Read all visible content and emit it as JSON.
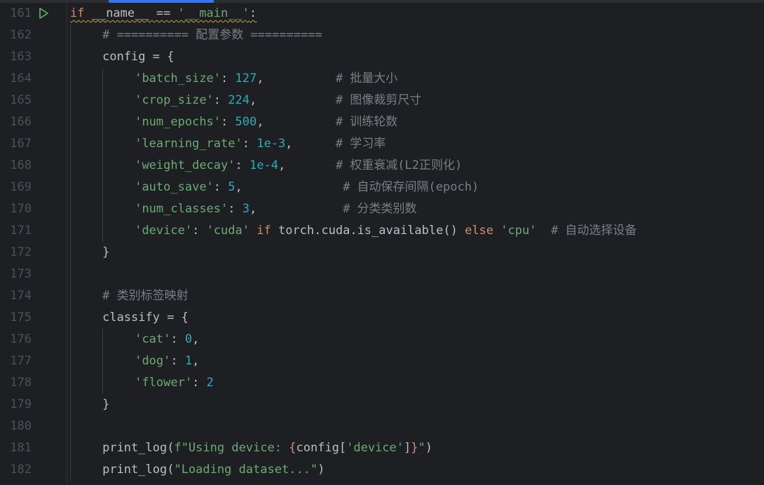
{
  "colors": {
    "background": "#1e1f22",
    "line_number": "#4b5059",
    "default": "#bcbec4",
    "keyword": "#cf8e6d",
    "string": "#6aab73",
    "number": "#2aacb8",
    "comment": "#7a7e85",
    "run_icon": "#5fb865"
  },
  "lines": [
    {
      "num": "161",
      "run": true,
      "indent": 0,
      "tokens": [
        {
          "t": "if",
          "c": "keyword",
          "sq": true
        },
        {
          "t": " __name__ == ",
          "c": "default",
          "sq": true
        },
        {
          "t": "'__main__'",
          "c": "string",
          "sq": true
        },
        {
          "t": ":",
          "c": "default",
          "sq": true
        }
      ]
    },
    {
      "num": "162",
      "indent": 4,
      "tokens": [
        {
          "t": "# ========== 配置参数 ==========",
          "c": "comment"
        }
      ]
    },
    {
      "num": "163",
      "indent": 4,
      "tokens": [
        {
          "t": "config = {",
          "c": "default"
        }
      ]
    },
    {
      "num": "164",
      "indent": 8,
      "tokens": [
        {
          "t": "'batch_size'",
          "c": "string"
        },
        {
          "t": ": ",
          "c": "default"
        },
        {
          "t": "127",
          "c": "number"
        },
        {
          "t": ",          ",
          "c": "default"
        },
        {
          "t": "# 批量大小",
          "c": "comment"
        }
      ]
    },
    {
      "num": "165",
      "indent": 8,
      "tokens": [
        {
          "t": "'crop_size'",
          "c": "string"
        },
        {
          "t": ": ",
          "c": "default"
        },
        {
          "t": "224",
          "c": "number"
        },
        {
          "t": ",           ",
          "c": "default"
        },
        {
          "t": "# 图像裁剪尺寸",
          "c": "comment"
        }
      ]
    },
    {
      "num": "166",
      "indent": 8,
      "tokens": [
        {
          "t": "'num_epochs'",
          "c": "string"
        },
        {
          "t": ": ",
          "c": "default"
        },
        {
          "t": "500",
          "c": "number"
        },
        {
          "t": ",          ",
          "c": "default"
        },
        {
          "t": "# 训练轮数",
          "c": "comment"
        }
      ]
    },
    {
      "num": "167",
      "indent": 8,
      "tokens": [
        {
          "t": "'learning_rate'",
          "c": "string"
        },
        {
          "t": ": ",
          "c": "default"
        },
        {
          "t": "1e-3",
          "c": "number"
        },
        {
          "t": ",      ",
          "c": "default"
        },
        {
          "t": "# 学习率",
          "c": "comment"
        }
      ]
    },
    {
      "num": "168",
      "indent": 8,
      "tokens": [
        {
          "t": "'weight_decay'",
          "c": "string"
        },
        {
          "t": ": ",
          "c": "default"
        },
        {
          "t": "1e-4",
          "c": "number"
        },
        {
          "t": ",       ",
          "c": "default"
        },
        {
          "t": "# 权重衰减(L2正则化)",
          "c": "comment"
        }
      ]
    },
    {
      "num": "169",
      "indent": 8,
      "tokens": [
        {
          "t": "'auto_save'",
          "c": "string"
        },
        {
          "t": ": ",
          "c": "default"
        },
        {
          "t": "5",
          "c": "number"
        },
        {
          "t": ",              ",
          "c": "default"
        },
        {
          "t": "# 自动保存间隔(epoch)",
          "c": "comment"
        }
      ]
    },
    {
      "num": "170",
      "indent": 8,
      "tokens": [
        {
          "t": "'num_classes'",
          "c": "string"
        },
        {
          "t": ": ",
          "c": "default"
        },
        {
          "t": "3",
          "c": "number"
        },
        {
          "t": ",            ",
          "c": "default"
        },
        {
          "t": "# 分类类别数",
          "c": "comment"
        }
      ]
    },
    {
      "num": "171",
      "indent": 8,
      "tokens": [
        {
          "t": "'device'",
          "c": "string"
        },
        {
          "t": ": ",
          "c": "default"
        },
        {
          "t": "'cuda'",
          "c": "string"
        },
        {
          "t": " ",
          "c": "default"
        },
        {
          "t": "if",
          "c": "keyword"
        },
        {
          "t": " torch.cuda.is_available() ",
          "c": "default"
        },
        {
          "t": "else",
          "c": "keyword"
        },
        {
          "t": " ",
          "c": "default"
        },
        {
          "t": "'cpu'",
          "c": "string"
        },
        {
          "t": "  ",
          "c": "default"
        },
        {
          "t": "# 自动选择设备",
          "c": "comment"
        }
      ]
    },
    {
      "num": "172",
      "indent": 4,
      "tokens": [
        {
          "t": "}",
          "c": "default"
        }
      ]
    },
    {
      "num": "173",
      "indent": 0,
      "tokens": []
    },
    {
      "num": "174",
      "indent": 4,
      "tokens": [
        {
          "t": "# 类别标签映射",
          "c": "comment"
        }
      ]
    },
    {
      "num": "175",
      "indent": 4,
      "tokens": [
        {
          "t": "classify = {",
          "c": "default"
        }
      ]
    },
    {
      "num": "176",
      "indent": 8,
      "tokens": [
        {
          "t": "'cat'",
          "c": "string"
        },
        {
          "t": ": ",
          "c": "default"
        },
        {
          "t": "0",
          "c": "number"
        },
        {
          "t": ",",
          "c": "default"
        }
      ]
    },
    {
      "num": "177",
      "indent": 8,
      "tokens": [
        {
          "t": "'dog'",
          "c": "string"
        },
        {
          "t": ": ",
          "c": "default"
        },
        {
          "t": "1",
          "c": "number"
        },
        {
          "t": ",",
          "c": "default"
        }
      ]
    },
    {
      "num": "178",
      "indent": 8,
      "tokens": [
        {
          "t": "'flower'",
          "c": "string"
        },
        {
          "t": ": ",
          "c": "default"
        },
        {
          "t": "2",
          "c": "number"
        }
      ]
    },
    {
      "num": "179",
      "indent": 4,
      "tokens": [
        {
          "t": "}",
          "c": "default"
        }
      ]
    },
    {
      "num": "180",
      "indent": 0,
      "tokens": []
    },
    {
      "num": "181",
      "indent": 4,
      "tokens": [
        {
          "t": "print_log(",
          "c": "default"
        },
        {
          "t": "f\"Using device: ",
          "c": "string"
        },
        {
          "t": "{",
          "c": "keyword"
        },
        {
          "t": "config[",
          "c": "default"
        },
        {
          "t": "'device'",
          "c": "string"
        },
        {
          "t": "]",
          "c": "default"
        },
        {
          "t": "}",
          "c": "keyword"
        },
        {
          "t": "\"",
          "c": "string"
        },
        {
          "t": ")",
          "c": "default"
        }
      ]
    },
    {
      "num": "182",
      "indent": 4,
      "tokens": [
        {
          "t": "print_log(",
          "c": "default"
        },
        {
          "t": "\"Loading dataset...\"",
          "c": "string"
        },
        {
          "t": ")",
          "c": "default"
        }
      ]
    }
  ]
}
